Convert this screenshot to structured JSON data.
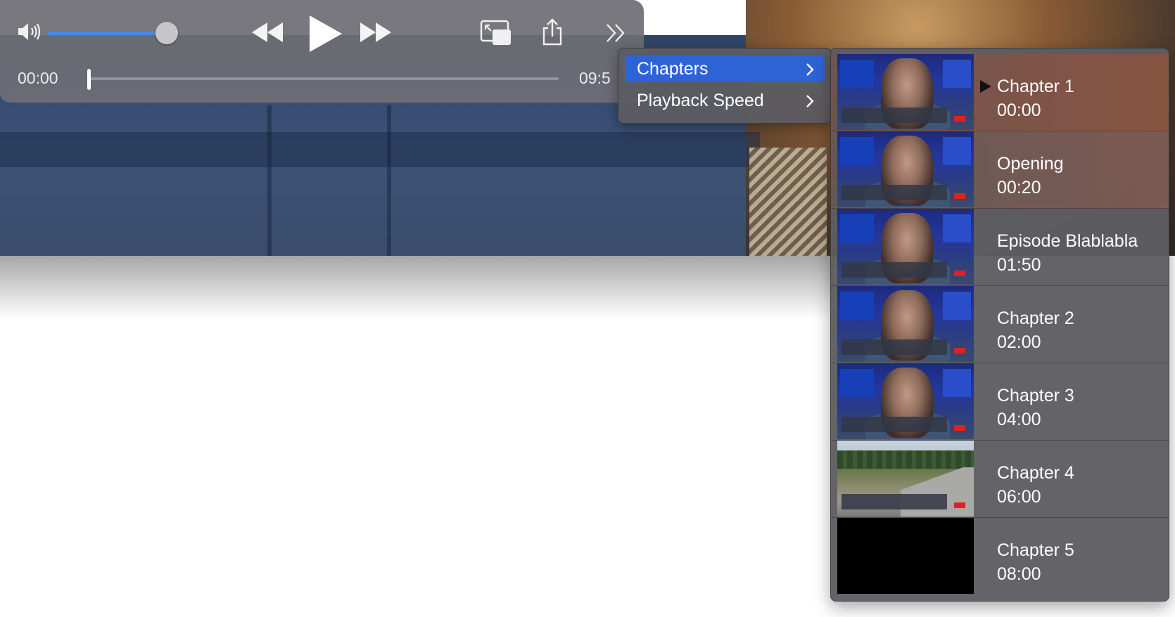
{
  "controls": {
    "current_time": "00:00",
    "duration": "09:5",
    "volume_level": 0.92,
    "progress": 0.0
  },
  "menu": {
    "items": [
      {
        "label": "Chapters",
        "selected": true
      },
      {
        "label": "Playback Speed",
        "selected": false
      }
    ]
  },
  "chapters": [
    {
      "title": "Chapter 1",
      "time": "00:00",
      "current": true,
      "thumb": "studio",
      "caption": "'ABSENCE OF TRUTH'"
    },
    {
      "title": "Opening",
      "time": "00:20",
      "current": false,
      "thumb": "studio",
      "caption": "'ABSENCE OF TRUTH'"
    },
    {
      "title": "Episode Blablabla",
      "time": "01:50",
      "current": false,
      "thumb": "studio",
      "caption": "'CONFECTED HIGH DRAMA'"
    },
    {
      "title": "Chapter 2",
      "time": "02:00",
      "current": false,
      "thumb": "studio",
      "caption": "'FINANCIAL ARMAGEDDON'"
    },
    {
      "title": "Chapter 3",
      "time": "04:00",
      "current": false,
      "thumb": "studio",
      "caption": "'CRIPPLING STUPIDITY'"
    },
    {
      "title": "Chapter 4",
      "time": "06:00",
      "current": false,
      "thumb": "road",
      "caption": "'IMMINENT DISASTERS'"
    },
    {
      "title": "Chapter 5",
      "time": "08:00",
      "current": false,
      "thumb": "black",
      "caption": ""
    }
  ],
  "colors": {
    "accent": "#2e63d6",
    "volume_fill": "#4a88e8"
  },
  "icons": {
    "volume": "speaker-volume-icon",
    "rewind": "rewind-icon",
    "play": "play-icon",
    "fast_forward": "fast-forward-icon",
    "pip": "picture-in-picture-icon",
    "share": "share-icon",
    "more": "more-chevrons-icon",
    "submenu": "chevron-right-icon",
    "current_chapter": "play-triangle-icon"
  }
}
